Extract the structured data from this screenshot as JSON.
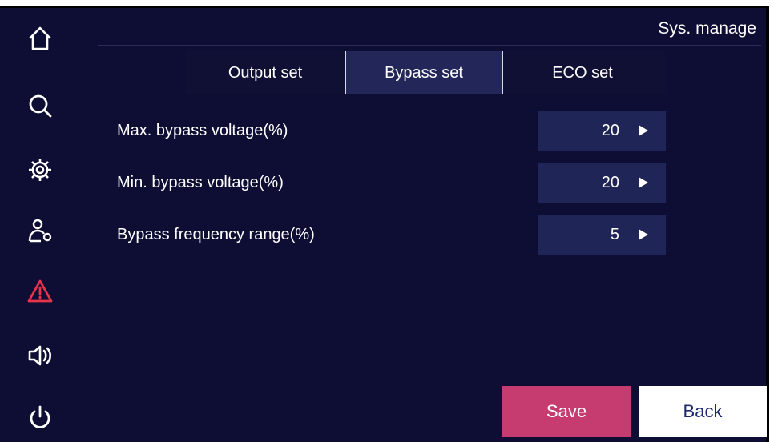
{
  "header": {
    "title": "Sys. manage"
  },
  "sidebar": {
    "items": [
      {
        "icon": "home-icon",
        "color": "#ffffff"
      },
      {
        "icon": "search-icon",
        "color": "#ffffff"
      },
      {
        "icon": "gear-icon",
        "color": "#ffffff"
      },
      {
        "icon": "user-settings-icon",
        "color": "#ffffff"
      },
      {
        "icon": "warning-icon",
        "color": "#e8334a"
      },
      {
        "icon": "speaker-icon",
        "color": "#ffffff"
      },
      {
        "icon": "power-icon",
        "color": "#ffffff"
      }
    ]
  },
  "tabs": [
    {
      "label": "Output set",
      "active": false
    },
    {
      "label": "Bypass set",
      "active": true
    },
    {
      "label": "ECO set",
      "active": false
    }
  ],
  "settings": [
    {
      "label": "Max. bypass voltage(%)",
      "value": "20"
    },
    {
      "label": "Min. bypass voltage(%)",
      "value": "20"
    },
    {
      "label": "Bypass frequency range(%)",
      "value": "5"
    }
  ],
  "buttons": {
    "save": "Save",
    "back": "Back"
  },
  "colors": {
    "background": "#0e0e34",
    "value_box": "#1f2556",
    "active_tab": "#232659",
    "save_button": "#c63c70",
    "back_button": "#ffffff",
    "warning": "#e8334a"
  }
}
